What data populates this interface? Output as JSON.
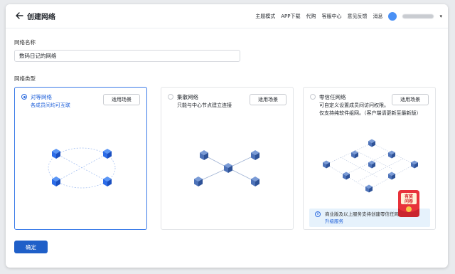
{
  "header": {
    "title": "创建网络",
    "nav": [
      "主题模式",
      "APP下载",
      "代购",
      "客服中心",
      "意见反馈",
      "消息"
    ]
  },
  "form": {
    "name_label": "网络名称",
    "name_value": "数码日记的网络",
    "type_label": "网络类型"
  },
  "cards": [
    {
      "title": "对等网络",
      "desc": [
        "各成员间均可互联"
      ],
      "button": "适用场景",
      "selected": true
    },
    {
      "title": "集散网络",
      "desc": [
        "只能与中心节点建立连接"
      ],
      "button": "适用场景",
      "selected": false
    },
    {
      "title": "零信任网络",
      "desc": [
        "可自定义设置成员间访问权限。",
        "仅支持纯软件组网。（客户端请更新至最新版）"
      ],
      "button": "适用场景",
      "selected": false
    }
  ],
  "notice": {
    "text": "商业版及以上服务支持创建零信任网络，可",
    "link": "升级服务"
  },
  "coupon": {
    "line1": "有奖",
    "line2": "问卷"
  },
  "confirm_label": "确定",
  "colors": {
    "accent": "#2f6de0",
    "primary_button": "#1f5fc8",
    "notice_bg": "#e6f2fc",
    "cube": "#2c6ce8"
  }
}
